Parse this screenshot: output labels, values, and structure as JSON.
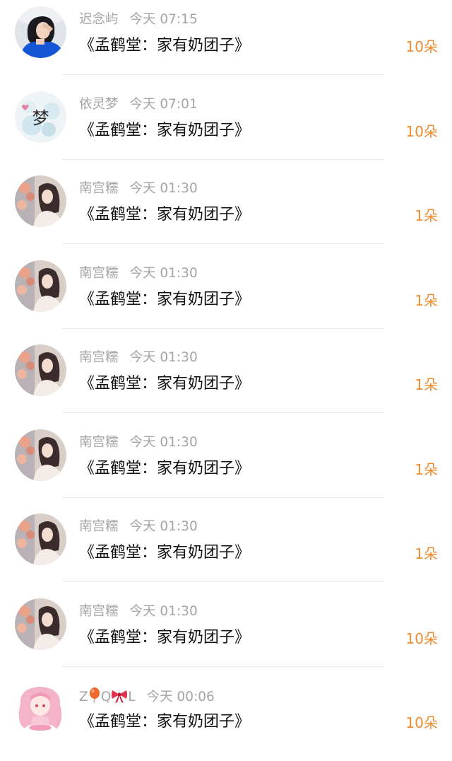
{
  "gifts": [
    {
      "user": "迟念屿",
      "time": "今天 07:15",
      "book": "《孟鹤堂：家有奶团子》",
      "count": "10朵",
      "avatar": "girl-blue-shirt-avatar"
    },
    {
      "user": "依灵梦",
      "time": "今天 07:01",
      "book": "《孟鹤堂：家有奶团子》",
      "count": "10朵",
      "avatar": "meng-character-floral-avatar"
    },
    {
      "user": "南宫糯",
      "time": "今天 01:30",
      "book": "《孟鹤堂：家有奶团子》",
      "count": "1朵",
      "avatar": "girl-with-flowers-avatar"
    },
    {
      "user": "南宫糯",
      "time": "今天 01:30",
      "book": "《孟鹤堂：家有奶团子》",
      "count": "1朵",
      "avatar": "girl-with-flowers-avatar"
    },
    {
      "user": "南宫糯",
      "time": "今天 01:30",
      "book": "《孟鹤堂：家有奶团子》",
      "count": "1朵",
      "avatar": "girl-with-flowers-avatar"
    },
    {
      "user": "南宫糯",
      "time": "今天 01:30",
      "book": "《孟鹤堂：家有奶团子》",
      "count": "1朵",
      "avatar": "girl-with-flowers-avatar"
    },
    {
      "user": "南宫糯",
      "time": "今天 01:30",
      "book": "《孟鹤堂：家有奶团子》",
      "count": "1朵",
      "avatar": "girl-with-flowers-avatar"
    },
    {
      "user": "南宫糯",
      "time": "今天 01:30",
      "book": "《孟鹤堂：家有奶团子》",
      "count": "10朵",
      "avatar": "girl-with-flowers-avatar"
    },
    {
      "user_parts": [
        "Z",
        "Q",
        "L"
      ],
      "user_emojis": [
        "balloon-emoji",
        "ribbon-emoji"
      ],
      "time": "今天 00:06",
      "book": "《孟鹤堂：家有奶团子》",
      "count": "10朵",
      "avatar": "pink-anime-girl-avatar"
    }
  ],
  "colors": {
    "count": "#f08a2a",
    "meta": "#a4a4a4",
    "title": "#111111",
    "divider": "#eeeeee"
  },
  "avatar_text": {
    "meng": "梦"
  }
}
